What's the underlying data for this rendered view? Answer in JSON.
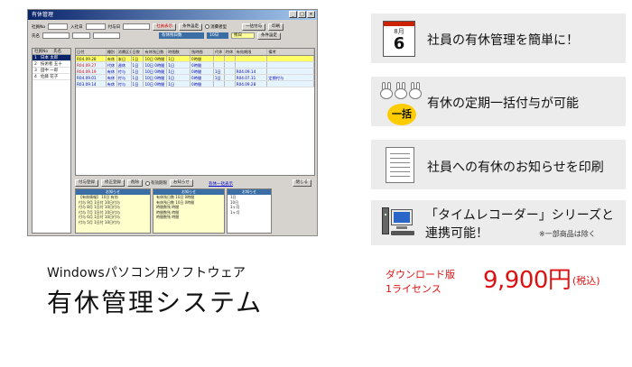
{
  "screenshot": {
    "window_title": "有休管理",
    "toolbar1": {
      "label_employee_no": "社員No",
      "label_name": "氏名",
      "label_hire": "入社日",
      "label_grant": "付与日",
      "btn_label": "社員表示",
      "btn_settings": "条件設定",
      "check_label": "消費者型"
    },
    "bars": {
      "blue1": "有休残日数",
      "blue2": "10日",
      "yellow1": "残日",
      "btn_grant": "一括付与",
      "btn_print": "印刷"
    },
    "employee_list": {
      "headers": [
        "社員No",
        "氏名"
      ],
      "rows": [
        {
          "no": "1",
          "name": "日本 太郎",
          "selected": true
        },
        {
          "no": "2",
          "name": "技術者 五十"
        },
        {
          "no": "3",
          "name": "田中 一郎"
        },
        {
          "no": "4",
          "name": "佐藤 花子"
        }
      ]
    },
    "grid": {
      "headers": [
        "日付",
        "種別",
        "消費区分",
        "日数",
        "有休残日数",
        "時間数",
        "残時間",
        "代休",
        "特休",
        "有効期限",
        "備考"
      ],
      "rows": [
        [
          "R04.09.28",
          "有休",
          "本日",
          "1日",
          "10日 0時間",
          "1日",
          "0時間",
          "",
          "",
          "",
          ""
        ],
        [
          "R04.09.27",
          "代休",
          "週休",
          "1日",
          "10日 0時間",
          "1日",
          "0時間",
          "",
          "",
          "",
          ""
        ],
        [
          "R04.09.19",
          "有休",
          "付与",
          "1日",
          "10日 0時間",
          "1日",
          "0時間",
          "1日",
          "",
          "R04.09.14",
          ""
        ],
        [
          "R04.09.01",
          "有休",
          "付与",
          "1日",
          "10日 0時間",
          "1日",
          "0時間",
          "1日",
          "",
          "R04.07.31",
          "定期付与"
        ],
        [
          "R03.09.14",
          "有休",
          "付与",
          "1日",
          "10日 0時間",
          "1日",
          "0時間",
          "",
          "",
          "R04.09.28",
          ""
        ]
      ]
    },
    "buttons": {
      "add": "付与登録",
      "edit": "修正登録",
      "delete": "削除",
      "radio": "有効期限",
      "notify": "お知らせ",
      "link": "有休一括表示",
      "close": "閉じる"
    },
    "notice": {
      "header": "お知らせ",
      "col1": [
        "【有休情報】 10日 有効",
        "付与 9月 1日付 10日付与",
        "付与 8月 1日付 10日付与",
        "付与 7月 1日付 10日付与",
        "付与 6月 1日付 10日付与",
        "付与 5月 1日付 10日付与"
      ],
      "col2": [
        "有休残日数 10日 0時間",
        "有休残日数 10日 0時間",
        "時間数残 時間",
        "時間数残 時間",
        "時間数残 時間"
      ],
      "col3": [
        "1日",
        "10日",
        "1ヶ月",
        "1ヶ月"
      ]
    }
  },
  "caption": {
    "subtitle": "Windowsパソコン用ソフトウェア",
    "title": "有休管理システム"
  },
  "features": [
    {
      "text": "社員の有休管理を簡単に！",
      "icon": "calendar-icon",
      "calendar_month": "8月",
      "calendar_day": "6"
    },
    {
      "text": "有休の定期一括付与が可能",
      "icon": "bunnies-icon",
      "badge": "一括"
    },
    {
      "text": "社員への有休のお知らせを印刷",
      "icon": "document-icon"
    },
    {
      "text_line1": "「タイムレコーダー」シリーズと",
      "text_line2": "連携可能！",
      "note": "※一部商品は除く",
      "icon": "computer-icon"
    }
  ],
  "price": {
    "edition": "ダウンロード版",
    "license": "1ライセンス",
    "amount": "9,900円",
    "tax": "(税込)"
  },
  "colors": {
    "accent_red": "#dd1111",
    "feature_bg": "#ececec",
    "window_blue": "#0a246a"
  }
}
